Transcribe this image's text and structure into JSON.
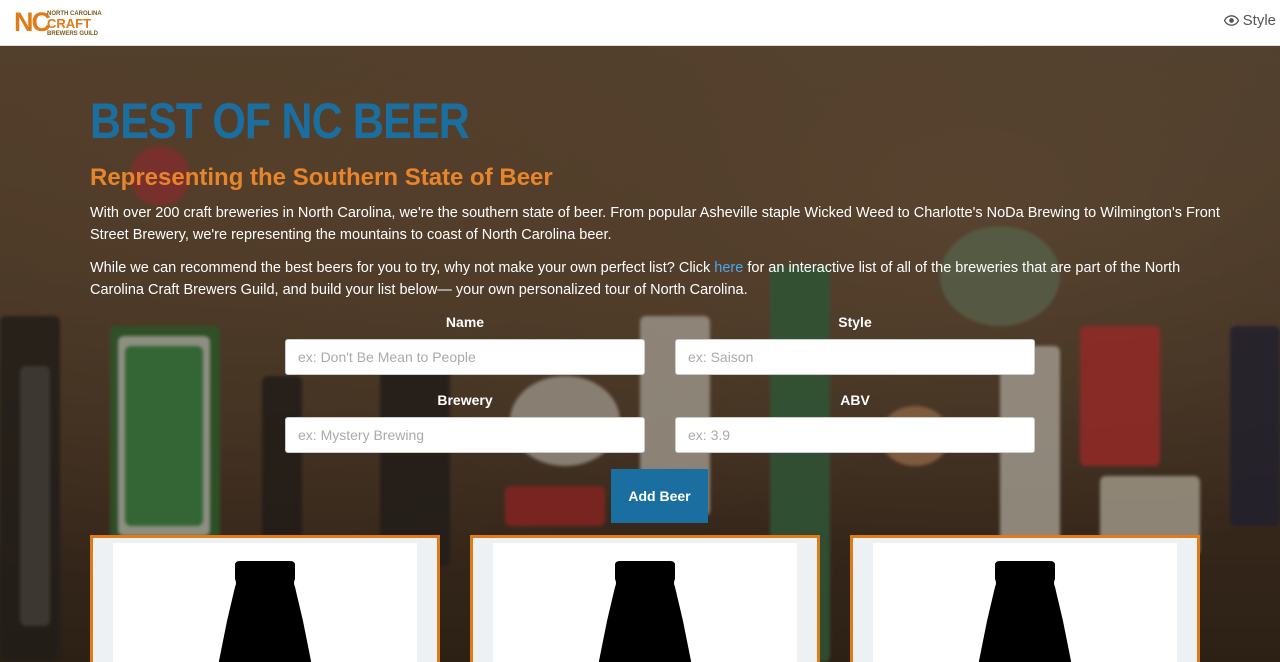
{
  "header": {
    "logo": {
      "nc": "NC",
      "line1": "NORTH CAROLINA",
      "line2": "CRAFT",
      "line3": "BREWERS GUILD"
    },
    "style_link": {
      "icon": "eye-icon",
      "label": "Style"
    }
  },
  "hero": {
    "title": "BEST OF NC BEER",
    "subtitle": "Representing the Southern State of Beer",
    "paragraph1": "With over 200 craft breweries in North Carolina, we're the southern state of beer. From popular Asheville staple Wicked Weed to Charlotte's NoDa Brewing to Wilmington's Front Street Brewery, we're representing the mountains to coast of North Carolina beer.",
    "paragraph2_before": "While we can recommend the best beers for you to try, why not make your own perfect list? Click ",
    "paragraph2_link": "here",
    "paragraph2_after": " for an interactive list of all of the breweries that are part of the North Carolina Craft Brewers Guild, and build your list below— your own personalized tour of North Carolina."
  },
  "form": {
    "name_label": "Name",
    "name_placeholder": "ex: Don't Be Mean to People",
    "style_label": "Style",
    "style_placeholder": "ex: Saison",
    "brewery_label": "Brewery",
    "brewery_placeholder": "ex: Mystery Brewing",
    "abv_label": "ABV",
    "abv_placeholder": "ex: 3.9",
    "add_button": "Add Beer"
  },
  "colors": {
    "title": "#1a6fa0",
    "subtitle": "#e8842a",
    "button": "#1a6fa0",
    "card_border": "#e07b1a"
  }
}
